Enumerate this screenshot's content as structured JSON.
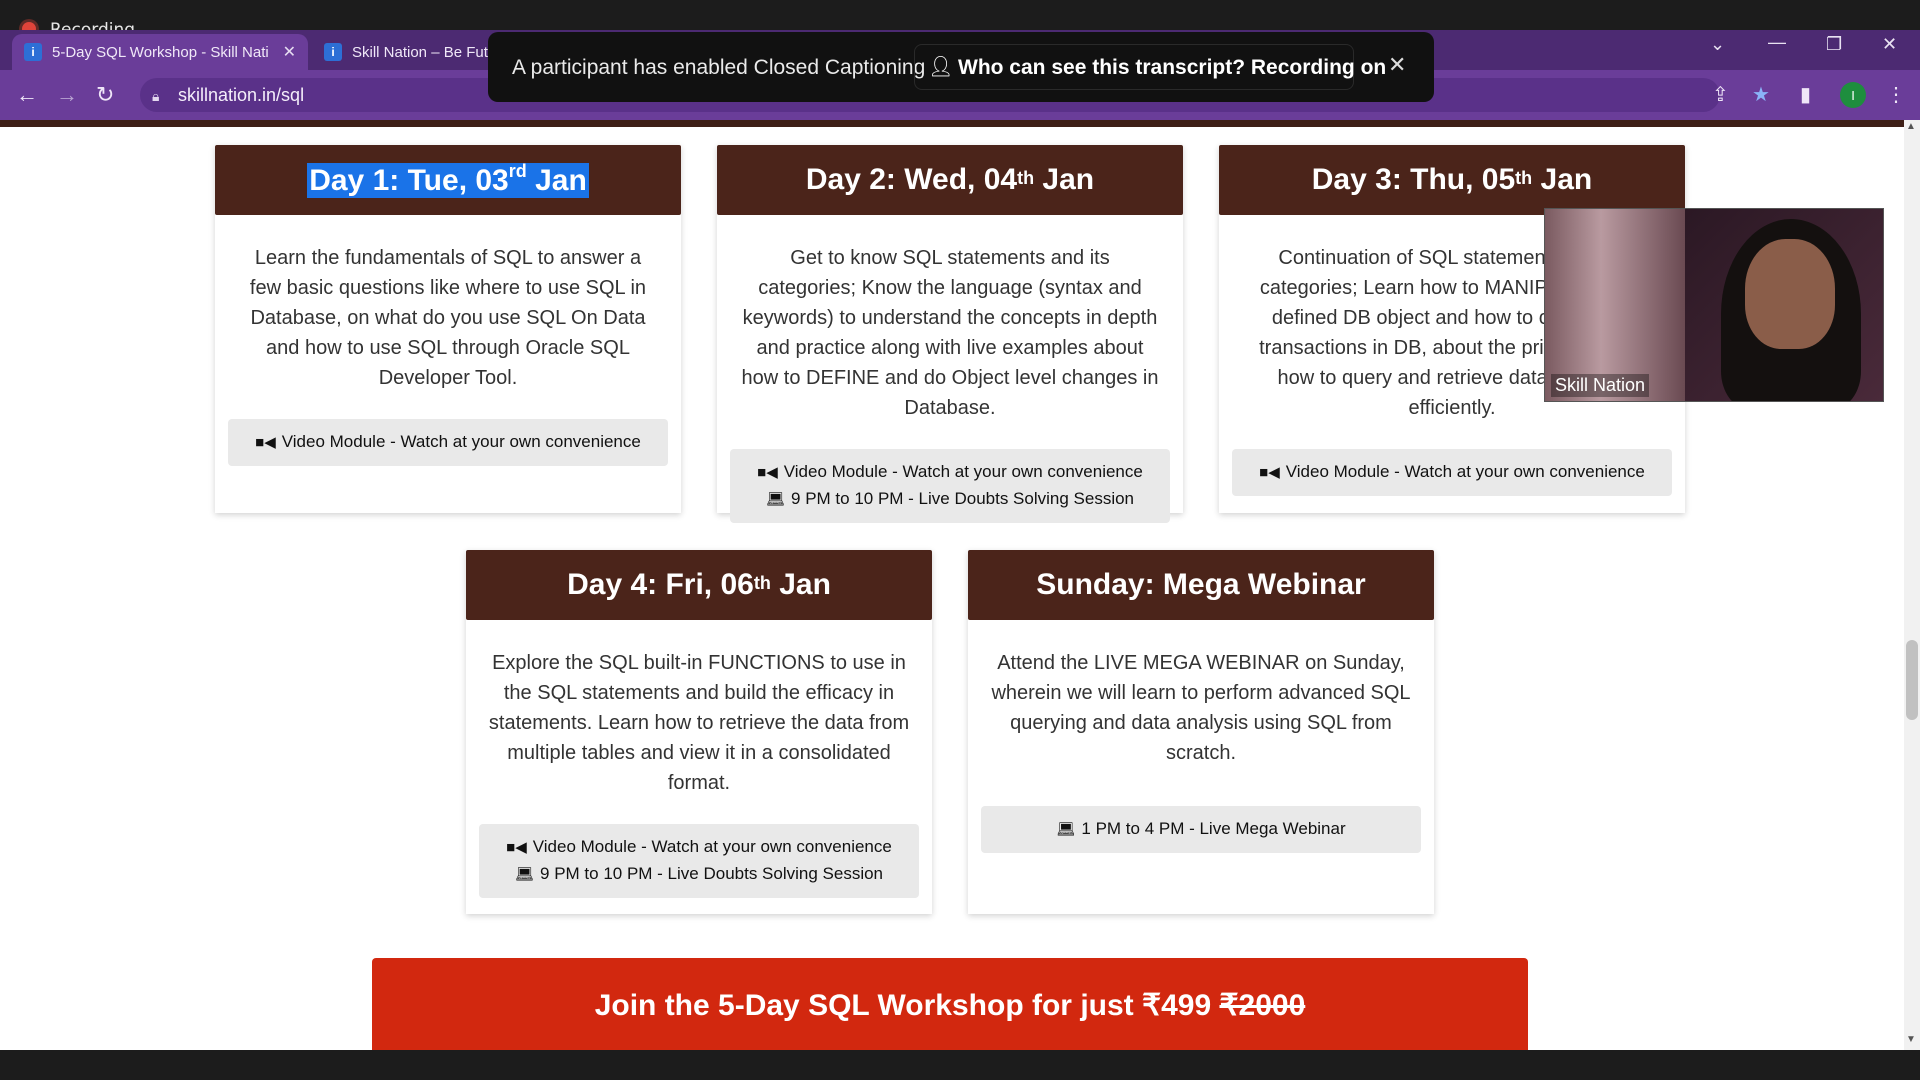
{
  "recording": {
    "label": "Recording"
  },
  "browser": {
    "tabs": [
      {
        "title": "5-Day SQL Workshop - Skill Nati"
      },
      {
        "title": "Skill Nation – Be Future Ready, To"
      }
    ],
    "url": "skillnation.in/sql",
    "profile_initial": "I"
  },
  "caption_banner": {
    "text": "A participant has enabled Closed Captioning",
    "who_text": "Who can see this transcript? Recording on"
  },
  "cards": [
    {
      "day": "Day 1: Tue, 03",
      "sup": "rd",
      "month": "Jan",
      "description": "Learn the fundamentals of SQL to answer a few basic questions like where to use SQL in Database, on what do you use SQL On Data and how to use SQL through Oracle SQL Developer Tool.",
      "lines": [
        "Video Module - Watch at your own convenience"
      ]
    },
    {
      "day": "Day 2: Wed, 04",
      "sup": "th",
      "month": "Jan",
      "description": "Get to know SQL statements and its categories; Know the language (syntax and keywords) to understand the concepts in depth and practice along with live examples about how to DEFINE and do Object level changes in Database.",
      "lines": [
        "Video Module - Watch at your own convenience",
        "9 PM to 10 PM - Live Doubts Solving Session"
      ]
    },
    {
      "day": "Day 3: Thu, 05",
      "sup": "th",
      "month": "Jan",
      "description": "Continuation of SQL statements and its categories; Learn how to MANIPULATE the defined DB object and how to control the transactions in DB, about the privileges and how to query and retrieve data from DB efficiently.",
      "lines": [
        "Video Module - Watch at your own convenience"
      ]
    },
    {
      "day": "Day 4: Fri, 06",
      "sup": "th",
      "month": "Jan",
      "description": "Explore the SQL built-in FUNCTIONS to use in the SQL statements and build the efficacy in statements. Learn how to retrieve the data from multiple tables and view it in a consolidated format.",
      "lines": [
        "Video Module - Watch at your own convenience",
        "9 PM to 10 PM - Live Doubts Solving Session"
      ]
    },
    {
      "day": "Sunday: Mega Webinar",
      "sup": "",
      "month": "",
      "description": "Attend the LIVE MEGA WEBINAR on Sunday, wherein we will learn to perform advanced SQL querying and data analysis using SQL from scratch.",
      "lines": [
        "1 PM to 4 PM - Live Mega Webinar"
      ]
    }
  ],
  "cta": {
    "prefix": "Join the 5-Day SQL Workshop for just ₹499",
    "old_price": "₹2000"
  },
  "video_tile": {
    "name": "Skill Nation"
  },
  "colors": {
    "card_header": "#4b241a",
    "cta": "#d2280f",
    "browser_accent": "#6a3d99"
  }
}
